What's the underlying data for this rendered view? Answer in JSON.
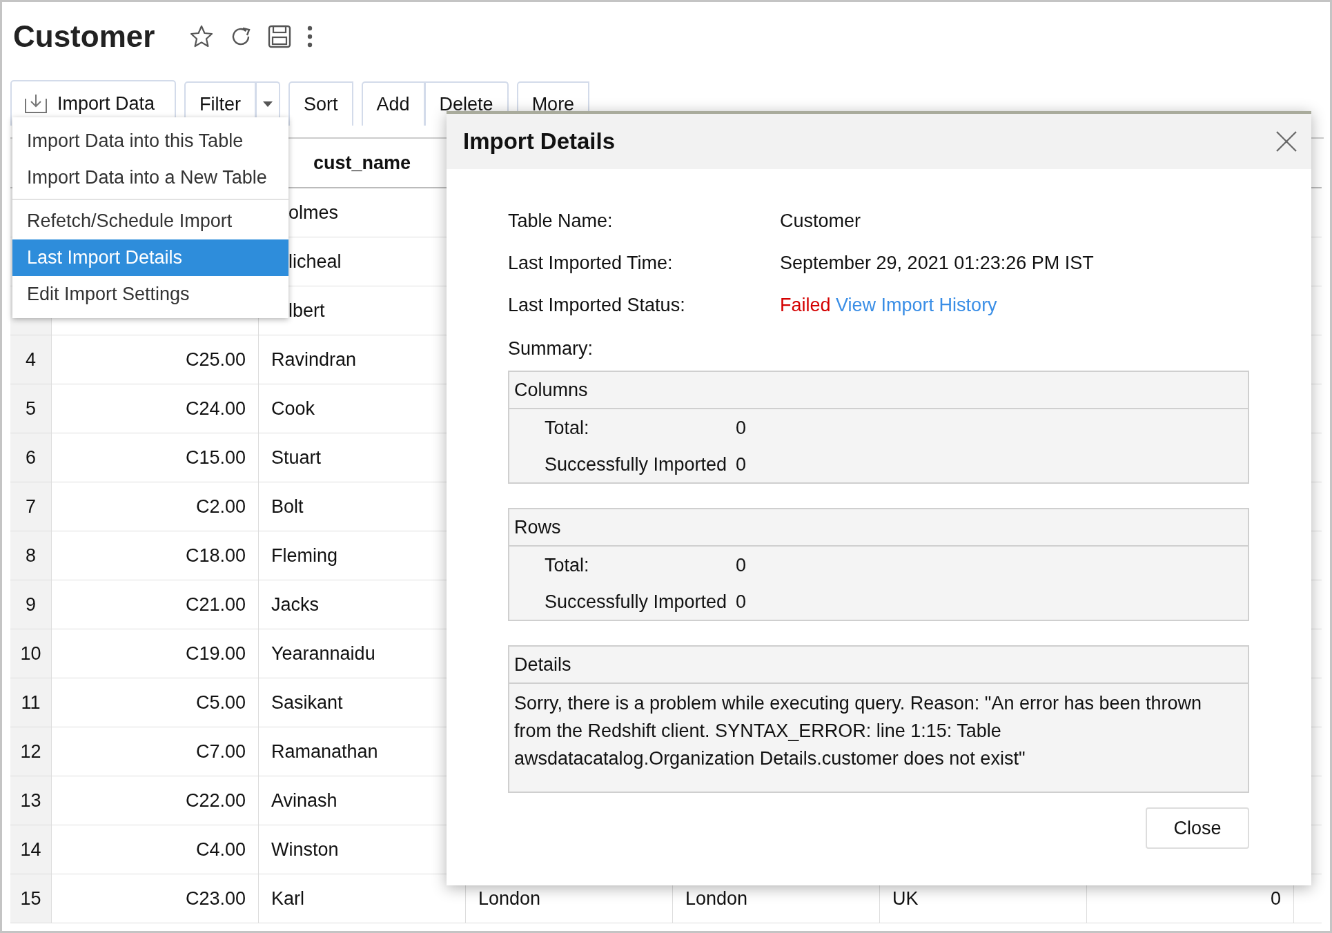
{
  "page": {
    "title": "Customer"
  },
  "toolbar": {
    "import": {
      "label": "Import Data",
      "expanded": true
    },
    "filter": {
      "label": "Filter"
    },
    "button_groups": [
      [
        {
          "label": "Sort"
        }
      ],
      [
        {
          "label": "Add"
        },
        {
          "label": "Delete"
        }
      ],
      [
        {
          "label": "More"
        }
      ]
    ]
  },
  "import_menu": {
    "sections": [
      [
        {
          "label": "Import Data into this Table",
          "selected": false
        },
        {
          "label": "Import Data into a New Table",
          "selected": false
        }
      ],
      [
        {
          "label": "Refetch/Schedule Import",
          "selected": false
        },
        {
          "label": "Last Import Details",
          "selected": true
        },
        {
          "label": "Edit Import Settings",
          "selected": false
        }
      ]
    ]
  },
  "table": {
    "header_label": "cust_name",
    "rows": [
      {
        "kind": "covered",
        "name": "olmes"
      },
      {
        "kind": "covered",
        "name": "licheal"
      },
      {
        "kind": "covered",
        "name": "lbert"
      },
      {
        "kind": "partial",
        "index": "4",
        "amount": "C25.00",
        "name": "Ravindran"
      },
      {
        "kind": "partial",
        "index": "5",
        "amount": "C24.00",
        "name": "Cook"
      },
      {
        "kind": "partial",
        "index": "6",
        "amount": "C15.00",
        "name": "Stuart"
      },
      {
        "kind": "partial",
        "index": "7",
        "amount": "C2.00",
        "name": "Bolt"
      },
      {
        "kind": "partial",
        "index": "8",
        "amount": "C18.00",
        "name": "Fleming"
      },
      {
        "kind": "partial",
        "index": "9",
        "amount": "C21.00",
        "name": "Jacks"
      },
      {
        "kind": "partial",
        "index": "10",
        "amount": "C19.00",
        "name": "Yearannaidu"
      },
      {
        "kind": "partial",
        "index": "11",
        "amount": "C5.00",
        "name": "Sasikant"
      },
      {
        "kind": "partial",
        "index": "12",
        "amount": "C7.00",
        "name": "Ramanathan"
      },
      {
        "kind": "partial",
        "index": "13",
        "amount": "C22.00",
        "name": "Avinash"
      },
      {
        "kind": "partial",
        "index": "14",
        "amount": "C4.00",
        "name": "Winston"
      },
      {
        "kind": "full",
        "index": "15",
        "amount": "C23.00",
        "name": "Karl",
        "column_4": "London",
        "column_5": "London",
        "column_6": "UK",
        "column_7": "0"
      }
    ]
  },
  "dialog": {
    "title": "Import Details",
    "fields": [
      {
        "label": "Table Name:",
        "value": "Customer"
      },
      {
        "label": "Last Imported Time:",
        "value": "September 29, 2021 01:23:26 PM IST"
      }
    ],
    "status": {
      "label": "Last Imported Status:",
      "value": "Failed",
      "link": "View Import History"
    },
    "summary_label": "Summary:",
    "sections": [
      {
        "kind": "counts",
        "title": "Columns",
        "items": [
          {
            "label": "Total:",
            "value": "0"
          },
          {
            "label": "Successfully Imported",
            "value": "0"
          }
        ]
      },
      {
        "kind": "counts",
        "title": "Rows",
        "items": [
          {
            "label": "Total:",
            "value": "0"
          },
          {
            "label": "Successfully Imported",
            "value": "0"
          }
        ]
      },
      {
        "kind": "message",
        "title": "Details",
        "text": "Sorry, there is a problem while executing query. Reason: \"An error has been thrown from the Redshift client. SYNTAX_ERROR: line 1:15: Table awsdatacatalog.Organization Details.customer does not exist\""
      }
    ],
    "close_button": "Close"
  }
}
